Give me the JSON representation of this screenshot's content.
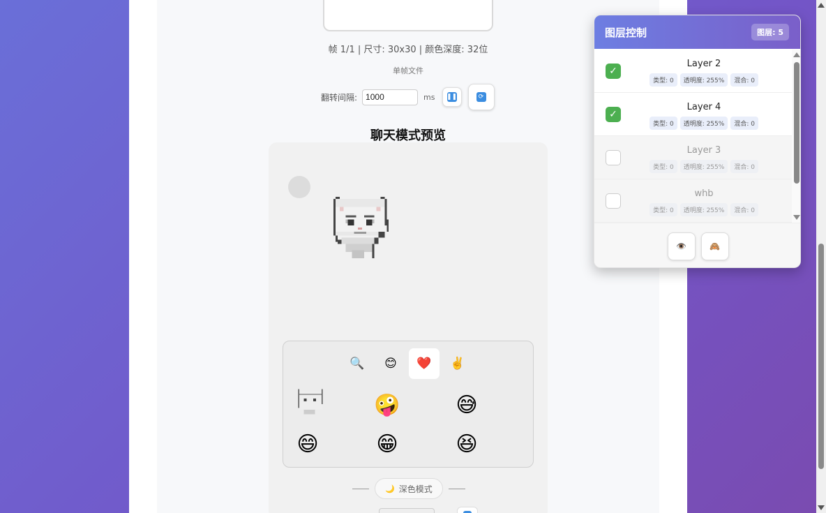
{
  "player": {
    "frame_info": "帧 1/1 | 尺寸: 30x30 | 颜色深度: 32位",
    "file_type": "单帧文件",
    "interval_label": "翻转间隔:",
    "interval_value": "1000",
    "interval_unit": "ms",
    "pause_icon": "pause-icon",
    "refresh_icon": "refresh-icon"
  },
  "chat": {
    "title": "聊天模式预览",
    "emoji_tabs": [
      {
        "icon": "🔍",
        "name": "search-tab"
      },
      {
        "icon": "😊",
        "name": "smile-tab"
      },
      {
        "icon": "❤️",
        "name": "heart-tab"
      },
      {
        "icon": "✌️",
        "name": "gesture-tab"
      }
    ],
    "active_tab": 2,
    "emojis": [
      "🤪",
      "😅",
      "😄",
      "😁",
      "😆"
    ],
    "dark_mode_label": "深色模式",
    "dark_mode_icon": "🌙"
  },
  "layers": {
    "title": "图层控制",
    "count": "图层: 5",
    "items": [
      {
        "name": "Layer 2",
        "enabled": true,
        "type": "类型: 0",
        "opacity": "透明度: 255%",
        "blend": "混合: 0"
      },
      {
        "name": "Layer 4",
        "enabled": true,
        "type": "类型: 0",
        "opacity": "透明度: 255%",
        "blend": "混合: 0"
      },
      {
        "name": "Layer 3",
        "enabled": false,
        "type": "类型: 0",
        "opacity": "透明度: 255%",
        "blend": "混合: 0"
      },
      {
        "name": "whb",
        "enabled": false,
        "type": "类型: 0",
        "opacity": "透明度: 255%",
        "blend": "混合: 0"
      }
    ],
    "footer_buttons": [
      {
        "icon": "👁️",
        "name": "show-all-button"
      },
      {
        "icon": "🙈",
        "name": "hide-all-button"
      }
    ],
    "colors": {
      "accent": "#6d7ee2",
      "checkbox_on": "#4caf50"
    }
  }
}
